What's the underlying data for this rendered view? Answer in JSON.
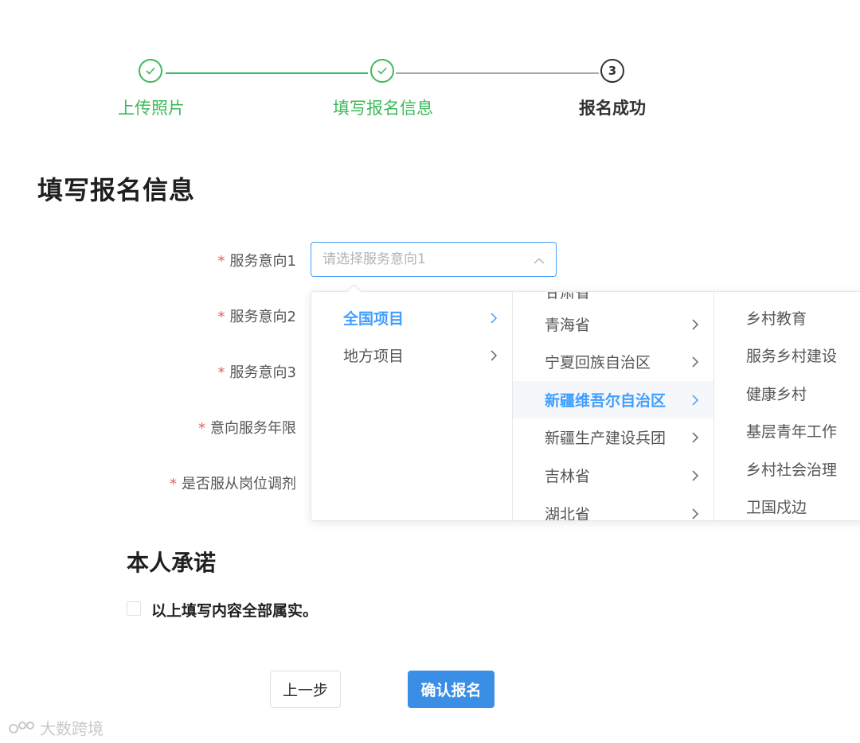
{
  "steps": [
    {
      "label": "上传照片",
      "status": "done"
    },
    {
      "label": "填写报名信息",
      "status": "done"
    },
    {
      "label": "报名成功",
      "status": "current",
      "number": "3"
    }
  ],
  "page_title": "填写报名信息",
  "form": {
    "required_mark": "*",
    "fields": [
      {
        "label": "服务意向1"
      },
      {
        "label": "服务意向2"
      },
      {
        "label": "服务意向3"
      },
      {
        "label": "意向服务年限"
      },
      {
        "label": "是否服从岗位调剂"
      }
    ],
    "select1": {
      "value": "",
      "placeholder": "请选择服务意向1"
    }
  },
  "cascader": {
    "level1": [
      {
        "label": "全国项目",
        "active": true
      },
      {
        "label": "地方项目",
        "active": false
      }
    ],
    "level2": [
      {
        "label": "甘肃省",
        "partial": true
      },
      {
        "label": "青海省"
      },
      {
        "label": "宁夏回族自治区"
      },
      {
        "label": "新疆维吾尔自治区",
        "active": true
      },
      {
        "label": "新疆生产建设兵团"
      },
      {
        "label": "吉林省"
      },
      {
        "label": "湖北省",
        "partial": true
      }
    ],
    "level3": [
      {
        "label": "乡村教育"
      },
      {
        "label": "服务乡村建设"
      },
      {
        "label": "健康乡村"
      },
      {
        "label": "基层青年工作"
      },
      {
        "label": "乡村社会治理"
      },
      {
        "label": "卫国戍边"
      }
    ]
  },
  "commitment": {
    "title": "本人承诺",
    "checkbox_label": "以上填写内容全部属实。",
    "checked": false
  },
  "buttons": {
    "prev": "上一步",
    "confirm": "确认报名"
  },
  "watermark": "大数跨境",
  "colors": {
    "success": "#3cb95a",
    "primary": "#409eff",
    "button_primary": "#3a8ee6",
    "required": "#e85a5a"
  }
}
